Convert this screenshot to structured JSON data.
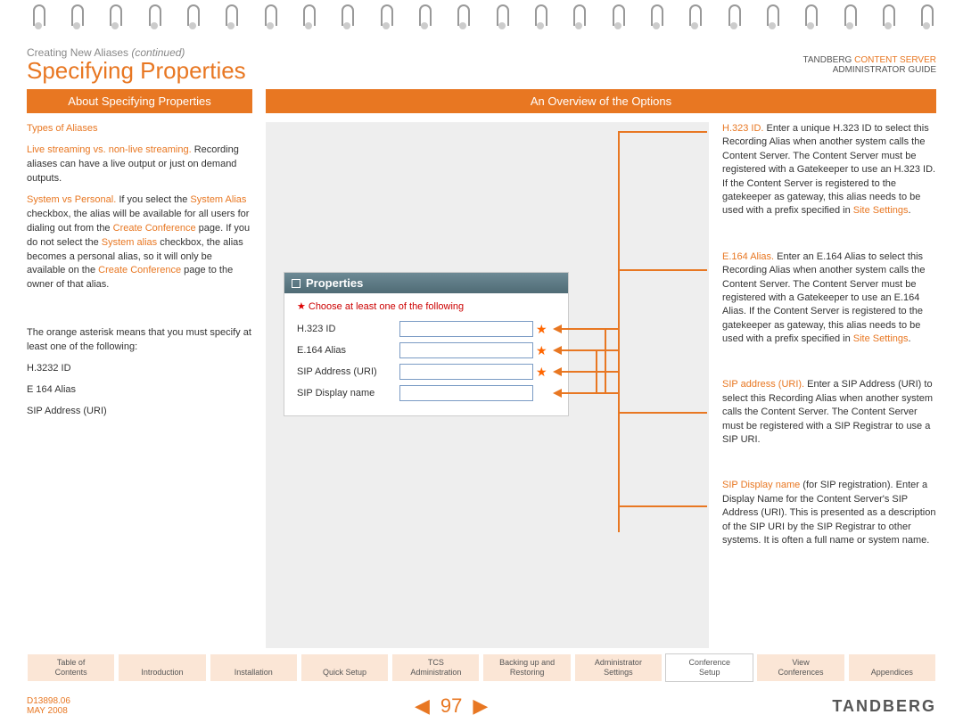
{
  "header": {
    "breadcrumb_main": "Creating New Aliases ",
    "breadcrumb_em": "(continued)",
    "title": "Specifying Properties",
    "top_right_brand": "TANDBERG ",
    "top_right_cs": "CONTENT SERVER",
    "top_right_sub": "ADMINISTRATOR GUIDE"
  },
  "tabs": {
    "left": "About Specifying Properties",
    "right": "An Overview of the Options"
  },
  "left_col": {
    "types": "Types of Aliases",
    "live": "Live streaming vs. non-live streaming.",
    "live_body": " Recording aliases can have a live output or just on demand outputs.",
    "sys_lead": "System vs Personal.",
    "sys_1": " If you select the ",
    "sys_link1": "System Alias",
    "sys_2": " checkbox, the alias will be available for all users for dialing out from the ",
    "sys_link2": "Create Conference",
    "sys_3": " page. If you do not select the ",
    "sys_link3": "System alias",
    "sys_4": " checkbox, the alias becomes a personal alias, so it will only be available on the ",
    "sys_link4": "Create Conference",
    "sys_5": " page to the owner of that alias.",
    "asterisk": "The orange asterisk means that you must specify at least one of the following:",
    "li1": "H.3232 ID",
    "li2": "E 164 Alias",
    "li3": "SIP Address (URI)"
  },
  "props": {
    "title": "Properties",
    "choose": "Choose at least one of the following",
    "f1": "H.323 ID",
    "f2": "E.164 Alias",
    "f3": "SIP Address (URI)",
    "f4": "SIP Display name"
  },
  "right_col": {
    "b1_lead": "H.323 ID.",
    "b1_body": " Enter a unique H.323 ID to select this Recording Alias when another system calls the Content Server. The Content Server must be registered with a Gatekeeper to use an H.323 ID. If the Content Server is registered to the gatekeeper as gateway, this alias needs to be used with a prefix specified in ",
    "b1_link": "Site Settings",
    "b1_end": ".",
    "b2_lead": "E.164 Alias.",
    "b2_body": " Enter an E.164 Alias to select this Recording Alias when another system calls the Content Server. The Content Server must be registered with a Gatekeeper to use an E.164 Alias. If the Content Server is registered to the gatekeeper as gateway, this alias needs to be used with a prefix specified in ",
    "b2_link": "Site Settings",
    "b2_end": ".",
    "b3_lead": "SIP address (URI).",
    "b3_body": " Enter a SIP Address (URI) to select this Recording Alias when another system calls the Content Server. The Content Server must be registered with a SIP Registrar to use a SIP URI.",
    "b4_lead": "SIP Display name",
    "b4_body": " (for SIP registration). Enter a Display Name for the Content Server's SIP Address (URI). This is presented as a description of the SIP URI by the SIP Registrar to other systems. It is often a full name or system name."
  },
  "nav": {
    "n0a": "Table of",
    "n0b": "Contents",
    "n1": "Introduction",
    "n2": "Installation",
    "n3": "Quick Setup",
    "n4a": "TCS",
    "n4b": "Administration",
    "n5a": "Backing up and",
    "n5b": "Restoring",
    "n6a": "Administrator",
    "n6b": "Settings",
    "n7a": "Conference",
    "n7b": "Setup",
    "n8a": "View",
    "n8b": "Conferences",
    "n9": "Appendices"
  },
  "footer": {
    "doc": "D13898.06",
    "date": "MAY 2008",
    "page": "97",
    "brand": "TANDBERG"
  }
}
